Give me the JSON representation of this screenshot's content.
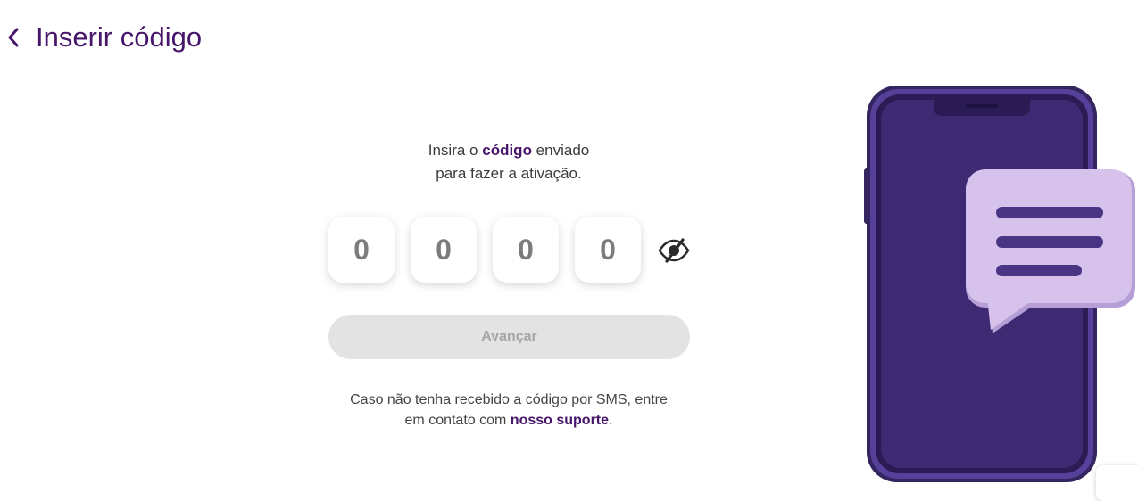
{
  "header": {
    "title": "Inserir código",
    "back_icon": "chevron-left-icon"
  },
  "intro": {
    "part1": "Insira o ",
    "highlight": "código",
    "part2": " enviado",
    "line2": "para fazer a ativação."
  },
  "code": {
    "digits": [
      "0",
      "0",
      "0",
      "0"
    ],
    "visibility_icon": "eye-off-icon"
  },
  "actions": {
    "advance_label": "Avançar"
  },
  "support": {
    "line1": "Caso não tenha recebido a código por SMS, entre",
    "line2_prefix": "em contato com ",
    "link": "nosso suporte",
    "suffix": "."
  },
  "colors": {
    "brand": "#47166b",
    "phone": "#3e2a73",
    "bubble": "#d7c2ec"
  }
}
